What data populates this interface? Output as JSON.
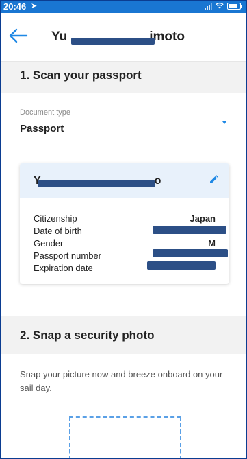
{
  "status_bar": {
    "time": "20:46",
    "location_icon": "location-arrow-icon",
    "signal_icon": "signal-icon",
    "wifi_icon": "wifi-icon",
    "battery_icon": "battery-icon"
  },
  "header": {
    "back_icon": "back-arrow-icon",
    "title_start": "Yu",
    "title_end": "imoto"
  },
  "section1": {
    "title": "1. Scan your passport"
  },
  "document_type": {
    "label": "Document type",
    "value": "Passport",
    "dropdown_icon": "dropdown-arrow-icon"
  },
  "passport_card": {
    "name_start": "Y",
    "name_end": "o",
    "edit_icon": "pencil-icon",
    "fields": [
      {
        "label": "Citizenship",
        "value": "Japan"
      },
      {
        "label": "Date of birth",
        "value": ""
      },
      {
        "label": "Gender",
        "value": "M"
      },
      {
        "label": "Passport number",
        "value": ""
      },
      {
        "label": "Expiration date",
        "value": ""
      }
    ]
  },
  "section2": {
    "title": "2. Snap a security photo",
    "description": "Snap your picture now and breeze onboard on your sail day."
  },
  "colors": {
    "accent": "#1e88e5",
    "status_bar": "#1976d2",
    "redaction": "#2c4f86",
    "card_header": "#e8f1fb",
    "section_band": "#f2f2f2"
  }
}
